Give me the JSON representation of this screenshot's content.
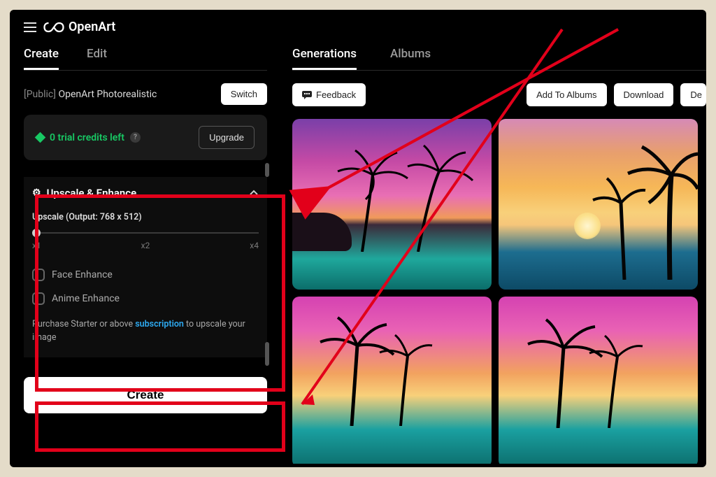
{
  "brand": "OpenArt",
  "sidebar": {
    "tabs": [
      {
        "label": "Create",
        "active": true
      },
      {
        "label": "Edit",
        "active": false
      }
    ],
    "model_prefix": "[Public] ",
    "model_name": "OpenArt Photorealistic",
    "switch_label": "Switch",
    "credits_text": "0 trial credits left",
    "upgrade_label": "Upgrade",
    "section_title": "Upscale & Enhance",
    "upscale_label": "Upscale (Output: 768 x 512)",
    "ticks": [
      "x1",
      "x2",
      "x4"
    ],
    "face_enhance": "Face Enhance",
    "anime_enhance": "Anime Enhance",
    "note_pre": "Purchase Starter or above ",
    "note_link": "subscription",
    "note_post": " to upscale your image",
    "create_label": "Create"
  },
  "main": {
    "tabs": [
      {
        "label": "Generations",
        "active": true
      },
      {
        "label": "Albums",
        "active": false
      }
    ],
    "feedback": "Feedback",
    "add_albums": "Add To Albums",
    "download": "Download",
    "delete": "De"
  }
}
